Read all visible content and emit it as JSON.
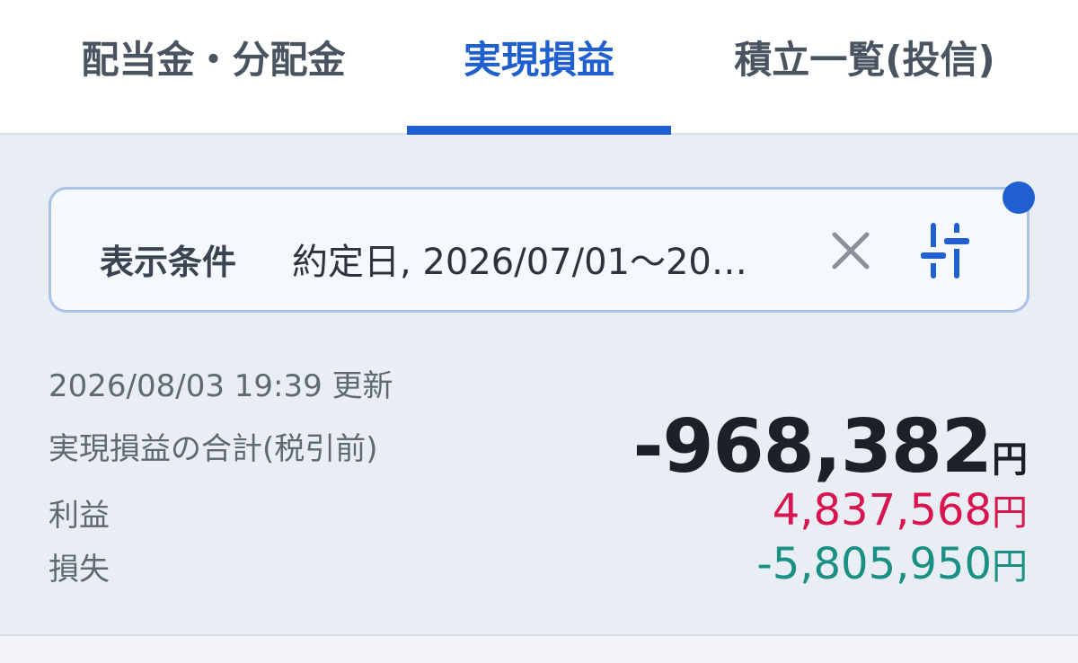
{
  "tabs": [
    {
      "label": "配当金・分配金",
      "active": false
    },
    {
      "label": "実現損益",
      "active": true
    },
    {
      "label": "積立一覧(投信)",
      "active": false
    }
  ],
  "filter": {
    "label": "表示条件",
    "value": "約定日, 2026/07/01〜20…",
    "clear_icon": "close-icon",
    "settings_icon": "sliders-icon",
    "has_badge": true
  },
  "summary": {
    "updated": "2026/08/03 19:39 更新",
    "total_label": "実現損益の合計(税引前)",
    "total_value": "-968,382",
    "profit_label": "利益",
    "profit_value": "4,837,568",
    "loss_label": "損失",
    "loss_value": "-5,805,950",
    "unit": "円"
  },
  "colors": {
    "accent": "#1f5fcf",
    "profit": "#d8154f",
    "loss": "#1a8f83",
    "background": "#e9eef5"
  }
}
